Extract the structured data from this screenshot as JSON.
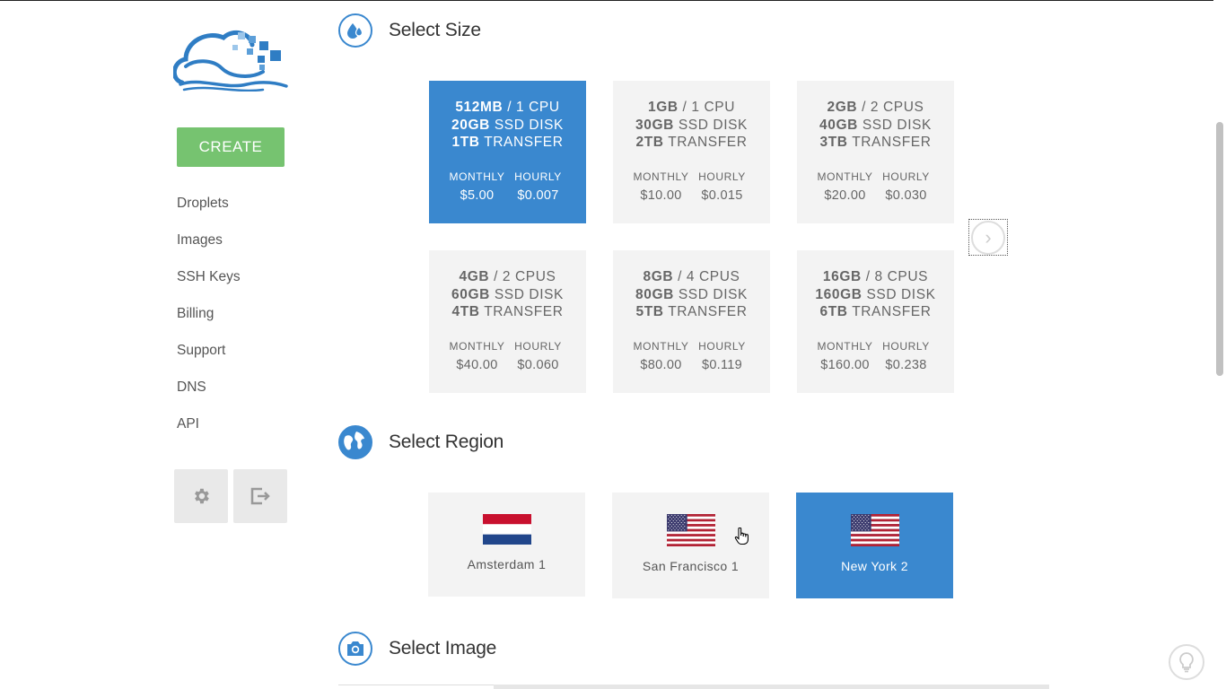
{
  "sidebar": {
    "create_label": "CREATE",
    "nav": [
      "Droplets",
      "Images",
      "SSH Keys",
      "Billing",
      "Support",
      "DNS",
      "API"
    ],
    "utility_icons": [
      "gear-icon",
      "logout-icon"
    ]
  },
  "sections": {
    "size": {
      "title": "Select Size",
      "icon": "droplets-icon"
    },
    "region": {
      "title": "Select Region",
      "icon": "globe-icon"
    },
    "image": {
      "title": "Select Image",
      "icon": "camera-icon"
    }
  },
  "price_labels": {
    "monthly": "MONTHLY",
    "hourly": "HOURLY"
  },
  "sizes": [
    {
      "ram": "512MB",
      "cpu": " / 1 CPU",
      "disk": "20GB",
      "disk_suffix": " SSD DISK",
      "transfer": "1TB",
      "transfer_suffix": " TRANSFER",
      "monthly": "$5.00",
      "hourly": "$0.007",
      "selected": true
    },
    {
      "ram": "1GB",
      "cpu": " / 1 CPU",
      "disk": "30GB",
      "disk_suffix": " SSD DISK",
      "transfer": "2TB",
      "transfer_suffix": " TRANSFER",
      "monthly": "$10.00",
      "hourly": "$0.015",
      "selected": false
    },
    {
      "ram": "2GB",
      "cpu": " / 2 CPUS",
      "disk": "40GB",
      "disk_suffix": " SSD DISK",
      "transfer": "3TB",
      "transfer_suffix": " TRANSFER",
      "monthly": "$20.00",
      "hourly": "$0.030",
      "selected": false
    },
    {
      "ram": "4GB",
      "cpu": " / 2 CPUS",
      "disk": "60GB",
      "disk_suffix": " SSD DISK",
      "transfer": "4TB",
      "transfer_suffix": " TRANSFER",
      "monthly": "$40.00",
      "hourly": "$0.060",
      "selected": false
    },
    {
      "ram": "8GB",
      "cpu": " / 4 CPUS",
      "disk": "80GB",
      "disk_suffix": " SSD DISK",
      "transfer": "5TB",
      "transfer_suffix": " TRANSFER",
      "monthly": "$80.00",
      "hourly": "$0.119",
      "selected": false
    },
    {
      "ram": "16GB",
      "cpu": " / 8 CPUS",
      "disk": "160GB",
      "disk_suffix": " SSD DISK",
      "transfer": "6TB",
      "transfer_suffix": " TRANSFER",
      "monthly": "$160.00",
      "hourly": "$0.238",
      "selected": false
    }
  ],
  "next_icon": "chevron-right-icon",
  "regions": [
    {
      "label": "Amsterdam 1",
      "flag": "netherlands-flag-icon",
      "selected": false
    },
    {
      "label": "San Francisco 1",
      "flag": "usa-flag-icon",
      "selected": false
    },
    {
      "label": "New York 2",
      "flag": "usa-flag-icon",
      "selected": true
    }
  ],
  "help_icon": "lightbulb-icon",
  "colors": {
    "accent": "#3a88cf",
    "create": "#76c370",
    "card": "#f3f3f3"
  }
}
